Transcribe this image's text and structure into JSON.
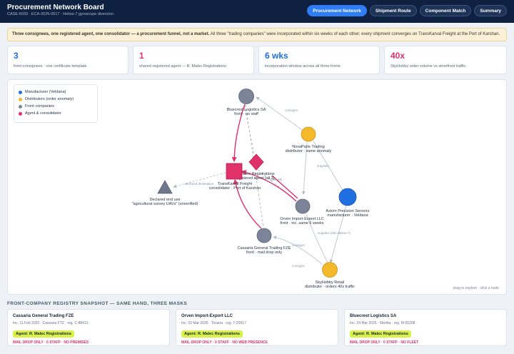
{
  "header": {
    "title": "Procurement Network Board",
    "subtitle": "CASE-6033 · ECA-2026-0517 · Helios-7 gyroscope diversion",
    "tabs": [
      {
        "label": "Procurement Network",
        "active": true
      },
      {
        "label": "Shipment Route",
        "active": false
      },
      {
        "label": "Component Match",
        "active": false
      },
      {
        "label": "Summary",
        "active": false
      }
    ]
  },
  "banner": {
    "lead": "Three consignees, one registered agent, one consolidator — a procurement funnel, not a market.",
    "body": " All three \"trading companies\" were incorporated within six weeks of each other; every shipment converges on TransKarval Freight at the Port of Karshan."
  },
  "kpis": [
    {
      "value": "3",
      "label": "front-consignees · one certificate template",
      "color": "#1f6fe0"
    },
    {
      "value": "1",
      "label": "shared registered agent — R. Malec Registrations",
      "color": "#e0316b"
    },
    {
      "value": "6 wks",
      "label": "incorporation window across all three fronts",
      "color": "#1f6fe0"
    },
    {
      "value": "40x",
      "label": "SkyHobby order volume vs storefront traffic",
      "color": "#e0316b"
    }
  ],
  "legend": [
    {
      "label": "Manufacturer (Veldana)",
      "color": "#1f6fe0"
    },
    {
      "label": "Distributors (order anomaly)",
      "color": "#f4b92b"
    },
    {
      "label": "Front companies",
      "color": "#7c8499"
    },
    {
      "label": "Agent & consolidator",
      "color": "#e0316b"
    }
  ],
  "graph": {
    "nodes": [
      {
        "id": "bluecrest",
        "shape": "circle",
        "kind": "front",
        "line1": "Bluecrest Logistics SA",
        "line2": "front · no staff"
      },
      {
        "id": "novaparts",
        "shape": "circle",
        "kind": "distributor",
        "line1": "NovaParts Trading",
        "line2": "distributor · same anomaly"
      },
      {
        "id": "transkarval",
        "shape": "square",
        "kind": "agent",
        "line1": "TransKarval Freight",
        "line2": "consolidator · Port of Karshan"
      },
      {
        "id": "malec",
        "shape": "diamond",
        "kind": "agent",
        "line1": "R. Malec Registrations",
        "line2": "registered agent (all 3)"
      },
      {
        "id": "enduse",
        "shape": "triangle",
        "kind": "front",
        "line1": "Declared end use",
        "line2": "\"agricultural survey UAVs\" (unverified)"
      },
      {
        "id": "orven",
        "shape": "circle",
        "kind": "front",
        "line1": "Orven Import-Export LLC",
        "line2": "front · inc. same 6 weeks"
      },
      {
        "id": "axiom",
        "shape": "circle",
        "kind": "manufacturer",
        "line1": "Axiom Precision Sensors",
        "line2": "manufacturer · Veldana"
      },
      {
        "id": "cassaria",
        "shape": "circle",
        "kind": "front",
        "line1": "Cassaria General Trading FZE",
        "line2": "front · mail drop only"
      },
      {
        "id": "skyhobby",
        "shape": "circle",
        "kind": "distributor",
        "line1": "SkyHobby Retail",
        "line2": "distributor · orders 40x traffic"
      }
    ],
    "edge_labels": [
      {
        "id": "consigns-nova",
        "text": "consigns"
      },
      {
        "id": "supplies-nova",
        "text": "supplies"
      },
      {
        "id": "declared",
        "text": "declared destination"
      },
      {
        "id": "forwards",
        "text": "forwards"
      },
      {
        "id": "consigns-orven",
        "text": "consigns"
      },
      {
        "id": "supplies-sky",
        "text": "supplies (40x Helios-7)"
      },
      {
        "id": "consigns-sky",
        "text": "consigns"
      }
    ],
    "hint": "drag to explore · click a node"
  },
  "registry": {
    "title": "FRONT-COMPANY REGISTRY SNAPSHOT — SAME HAND, THREE MASKS",
    "cards": [
      {
        "name": "Cassaria General Trading FZE",
        "meta": "Inc. 11 Feb 2025 · Cassaria FTZ · reg. C-88413",
        "agent": "Agent: R. Malec Registrations",
        "flags": "MAIL DROP ONLY · 0 STAFF · NO PREMISES"
      },
      {
        "name": "Orven Import-Export LLC",
        "meta": "Inc. 02 Mar 2025 · Tovaria · reg. T-20917",
        "agent": "Agent: R. Malec Registrations",
        "flags": "MAIL DROP ONLY · 0 STAFF · NO WEB PRESENCE"
      },
      {
        "name": "Bluecrest Logistics SA",
        "meta": "Inc. 24 Mar 2025 · Merdia · reg. M-55208",
        "agent": "Agent: R. Malec Registrations",
        "flags": "MAIL DROP ONLY · 0 STAFF · NO FLEET"
      }
    ]
  }
}
